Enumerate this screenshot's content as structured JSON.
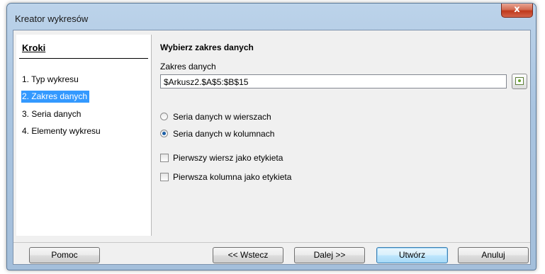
{
  "window": {
    "title": "Kreator wykresów",
    "close_label": "x"
  },
  "steps": {
    "title": "Kroki",
    "items": [
      {
        "label": "1. Typ wykresu",
        "active": false
      },
      {
        "label": "2. Zakres danych",
        "active": true
      },
      {
        "label": "3. Seria danych",
        "active": false
      },
      {
        "label": "4. Elementy wykresu",
        "active": false
      }
    ]
  },
  "panel": {
    "title": "Wybierz zakres danych",
    "range_label": "Zakres danych",
    "range_value": "$Arkusz2.$A$5:$B$15",
    "range_button_icon": "select-range-icon",
    "options": [
      {
        "type": "radio",
        "label": "Seria danych w wierszach",
        "checked": false
      },
      {
        "type": "radio",
        "label": "Seria danych w kolumnach",
        "checked": true
      },
      {
        "type": "checkbox",
        "label": "Pierwszy wiersz jako etykieta",
        "checked": false
      },
      {
        "type": "checkbox",
        "label": "Pierwsza kolumna jako etykieta",
        "checked": false
      }
    ]
  },
  "buttons": {
    "help": "Pomoc",
    "back": "<< Wstecz",
    "next": "Dalej >>",
    "finish": "Utwórz",
    "cancel": "Anuluj"
  },
  "colors": {
    "selection": "#3399ff",
    "close_button": "#c7432a"
  }
}
